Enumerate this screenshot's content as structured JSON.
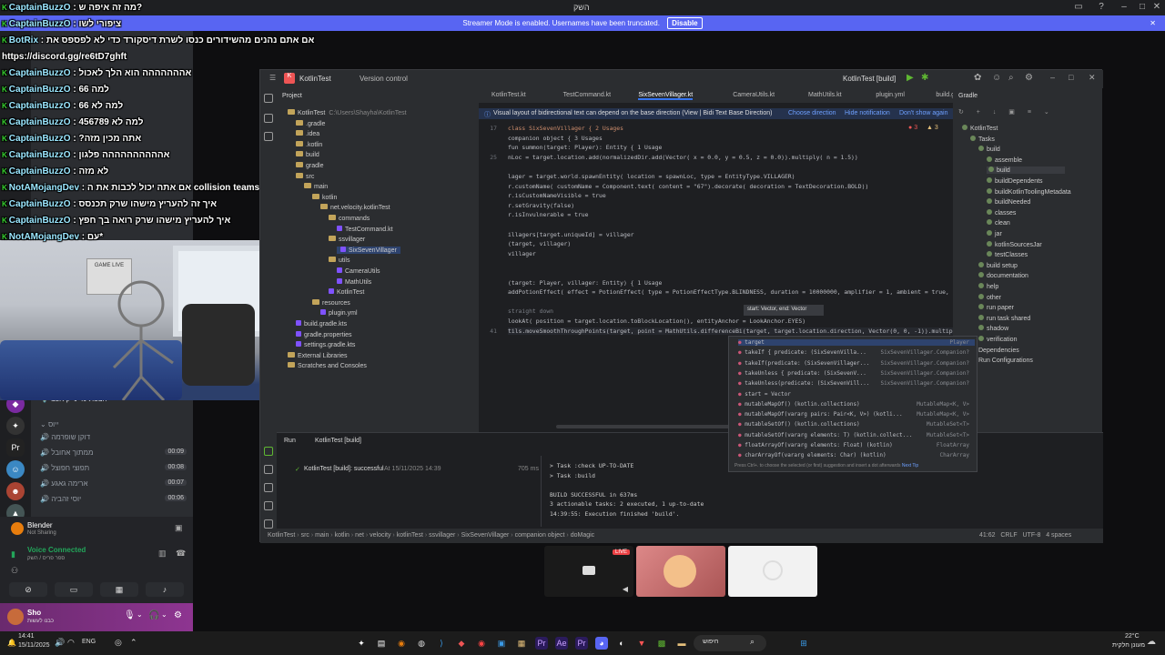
{
  "discord": {
    "window_title": "השק",
    "streamer_banner": "Streamer Mode is enabled. Usernames have been truncated.",
    "disable_label": "Disable",
    "voice": {
      "status": "Voice Connected",
      "sub": "ספר פריס / השק",
      "app_name": "Blender",
      "app_sub": "Not Sharing"
    },
    "user": {
      "name": "Sho",
      "sub": "כבנו לעשות"
    },
    "channels_header": "ייוס",
    "channels": [
      {
        "name": "דוקן שופרמה",
        "count": ""
      },
      {
        "name": "ממתוך אחובל",
        "count": "00:09"
      },
      {
        "name": "תפוצי חפוצל",
        "count": "00:08"
      },
      {
        "name": "ארימה גאגע",
        "count": "00:07"
      },
      {
        "name": "יוסי זהביה",
        "count": "00:06"
      }
    ],
    "channel_highlight": "הצפת-מי-נייק אפצ",
    "live_badge": "LIVE"
  },
  "chat": [
    {
      "user": "CaptainBuzzO",
      "text": "מה זה איפה ש?"
    },
    {
      "user": "CaptainBuzzO",
      "text": "ציפורי לשו"
    },
    {
      "user": "BotRix",
      "text": "אם אתם נהנים מהשידורים כנסו לשרת דיסקורד כדי לא לפספס את"
    },
    {
      "user": "",
      "text": "https://discord.gg/re6tD7ghft"
    },
    {
      "user": "CaptainBuzzO",
      "text": "אההההההה הוא הלך לאכול"
    },
    {
      "user": "CaptainBuzzO",
      "text": "למה 66"
    },
    {
      "user": "CaptainBuzzO",
      "text": "למה לא 66"
    },
    {
      "user": "CaptainBuzzO",
      "text": "למה לא 456789"
    },
    {
      "user": "CaptainBuzzO",
      "text": "?אתה מכין מזה"
    },
    {
      "user": "CaptainBuzzO",
      "text": "אהההההההההה פלגון"
    },
    {
      "user": "CaptainBuzzO",
      "text": "לא מזה"
    },
    {
      "user": "NotAMojangDev",
      "text": "אם אתה יכול לכבות את ה collision teams"
    },
    {
      "user": "CaptainBuzzO",
      "text": "איך זה להעריץ מישהו שרק תכנסס"
    },
    {
      "user": "CaptainBuzzO",
      "text": "איך להעריץ מישהו שרק רואה בך חפץ"
    },
    {
      "user": "NotAMojangDev",
      "text": "עם*"
    }
  ],
  "ide": {
    "project_name": "KotlinTest",
    "vcs": "Version control",
    "run_config": "KotlinTest [build]",
    "tabs": [
      "KotlinTest.kt",
      "TestCommand.kt",
      "SixSevenVillager.kt",
      "CameraUtils.kt",
      "MathUtils.kt",
      "plugin.yml",
      "build.gradle"
    ],
    "active_tab": "SixSevenVillager.kt",
    "notice": "Visual layout of bidirectional text can depend on the base direction (View | Bidi Text Base Direction)",
    "notice_actions": [
      "Choose direction",
      "Hide notification",
      "Don't show again"
    ],
    "project_panel_title": "Project",
    "project_tree": [
      {
        "label": "KotlinTest",
        "note": "C:\\Users\\Shayha\\KotlinTest",
        "type": "folder",
        "level": 0
      },
      {
        "label": ".gradle",
        "type": "folder",
        "level": 1
      },
      {
        "label": ".idea",
        "type": "folder",
        "level": 1
      },
      {
        "label": ".kotlin",
        "type": "folder",
        "level": 1
      },
      {
        "label": "build",
        "type": "folder",
        "level": 1
      },
      {
        "label": "gradle",
        "type": "folder",
        "level": 1
      },
      {
        "label": "src",
        "type": "folder",
        "level": 1
      },
      {
        "label": "main",
        "type": "folder",
        "level": 2
      },
      {
        "label": "kotlin",
        "type": "folder",
        "level": 3
      },
      {
        "label": "net.velocity.kotlinTest",
        "type": "folder",
        "level": 4
      },
      {
        "label": "commands",
        "type": "folder",
        "level": 5
      },
      {
        "label": "TestCommand.kt",
        "type": "kt",
        "level": 6
      },
      {
        "label": "ssvillager",
        "type": "folder",
        "level": 5
      },
      {
        "label": "SixSevenVillager",
        "type": "kt",
        "level": 6
      },
      {
        "label": "utils",
        "type": "folder",
        "level": 5
      },
      {
        "label": "CameraUtils",
        "type": "kt",
        "level": 6
      },
      {
        "label": "MathUtils",
        "type": "kt",
        "level": 6
      },
      {
        "label": "KotlinTest",
        "type": "kt",
        "level": 5
      },
      {
        "label": "resources",
        "type": "folder",
        "level": 3
      },
      {
        "label": "plugin.yml",
        "type": "kt",
        "level": 4
      },
      {
        "label": "build.gradle.kts",
        "type": "kt",
        "level": 1
      },
      {
        "label": "gradle.properties",
        "type": "kt",
        "level": 1
      },
      {
        "label": "settings.gradle.kts",
        "type": "kt",
        "level": 1
      },
      {
        "label": "External Libraries",
        "type": "folder",
        "level": 0
      },
      {
        "label": "Scratches and Consoles",
        "type": "folder",
        "level": 0
      }
    ],
    "gradle_title": "Gradle",
    "gradle_tree": [
      {
        "label": "KotlinTest",
        "level": 0
      },
      {
        "label": "Tasks",
        "level": 1
      },
      {
        "label": "build",
        "level": 2
      },
      {
        "label": "assemble",
        "level": 3
      },
      {
        "label": "build",
        "level": 3
      },
      {
        "label": "buildDependents",
        "level": 3
      },
      {
        "label": "buildKotlinToolingMetadata",
        "level": 3
      },
      {
        "label": "buildNeeded",
        "level": 3
      },
      {
        "label": "classes",
        "level": 3
      },
      {
        "label": "clean",
        "level": 3
      },
      {
        "label": "jar",
        "level": 3
      },
      {
        "label": "kotlinSourcesJar",
        "level": 3
      },
      {
        "label": "testClasses",
        "level": 3
      },
      {
        "label": "build setup",
        "level": 2
      },
      {
        "label": "documentation",
        "level": 2
      },
      {
        "label": "help",
        "level": 2
      },
      {
        "label": "other",
        "level": 2
      },
      {
        "label": "run paper",
        "level": 2
      },
      {
        "label": "run task shared",
        "level": 2
      },
      {
        "label": "shadow",
        "level": 2
      },
      {
        "label": "verification",
        "level": 2
      },
      {
        "label": "Dependencies",
        "level": 1
      },
      {
        "label": "Run Configurations",
        "level": 1
      }
    ],
    "code_lines": [
      {
        "n": "17",
        "t": "class SixSevenVillager {  2 Usages"
      },
      {
        "n": "",
        "t": "    companion object {  3 Usages"
      },
      {
        "n": "",
        "t": "        fun summon(target: Player): Entity {  1 Usage"
      },
      {
        "n": "25",
        "t": "nLoc = target.location.add(normalizedDir.add(Vector( x = 0.0,  y = 0.5,  z = 0.0)).multiply( n = 1.5))"
      },
      {
        "n": "",
        "t": ""
      },
      {
        "n": "",
        "t": "lager = target.world.spawnEntity( location = spawnLoc,  type = EntityType.VILLAGER)"
      },
      {
        "n": "",
        "t": "r.customName( customName = Component.text( content = \"67\").decorate( decoration = TextDecoration.BOLD))"
      },
      {
        "n": "",
        "t": "r.isCustomNameVisible = true"
      },
      {
        "n": "",
        "t": "r.setGravity(false)"
      },
      {
        "n": "",
        "t": "r.isInvulnerable = true"
      },
      {
        "n": "",
        "t": ""
      },
      {
        "n": "",
        "t": "illagers[target.uniqueId] = villager"
      },
      {
        "n": "",
        "t": "(target, villager)"
      },
      {
        "n": "",
        "t": "villager"
      },
      {
        "n": "",
        "t": ""
      },
      {
        "n": "",
        "t": ""
      },
      {
        "n": "",
        "t": "(target: Player, villager: Entity) {  1 Usage"
      },
      {
        "n": "",
        "t": "addPotionEffect( effect = PotionEffect( type = PotionEffectType.BLINDNESS,  duration = 10000000,  amplifier = 1,  ambient = true,  partic"
      },
      {
        "n": "",
        "t": ""
      },
      {
        "n": "",
        "t": " straight down"
      },
      {
        "n": "",
        "t": "lookAt( position = target.location.toBlockLocation(),  entityAnchor = LookAnchor.EYES)"
      },
      {
        "n": "41",
        "t": "tils.moveSmoothThroughPoints(target,  point = MathUtils.differenceBi(target, target.location.direction, Vector(0, 0, -1)).multiply(1.7"
      }
    ],
    "param_tip": "start: Vector, end: Vector",
    "autocomplete": [
      {
        "name": "target",
        "type": "Player"
      },
      {
        "name": "takeIf { predicate: (SixSevenVilla...",
        "type": "SixSevenVillager.Companion?"
      },
      {
        "name": "takeIf(predicate: (SixSevenVillager...",
        "type": "SixSevenVillager.Companion?"
      },
      {
        "name": "takeUnless { predicate: (SixSevenV...",
        "type": "SixSevenVillager.Companion?"
      },
      {
        "name": "takeUnless(predicate: (SixSevenVill...",
        "type": "SixSevenVillager.Companion?"
      },
      {
        "name": "start = Vector",
        "type": ""
      },
      {
        "name": "mutableMapOf() (kotlin.collections)",
        "type": "MutableMap<K, V>"
      },
      {
        "name": "mutableMapOf(vararg pairs: Pair<K, V>) (kotli...",
        "type": "MutableMap<K, V>"
      },
      {
        "name": "mutableSetOf() (kotlin.collections)",
        "type": "MutableSet<T>"
      },
      {
        "name": "mutableSetOf(vararg elements: T) (kotlin.collect...",
        "type": "MutableSet<T>"
      },
      {
        "name": "floatArrayOf(vararg elements: Float) (kotlin)",
        "type": "FloatArray"
      },
      {
        "name": "charArrayOf(vararg elements: Char) (kotlin)",
        "type": "CharArray"
      }
    ],
    "ac_footer": "Press Ctrl+. to choose the selected (or first) suggestion and insert a dot afterwards",
    "ac_footer_link": "Next Tip",
    "run_tab": "Run",
    "run_config_tab": "KotlinTest [build]",
    "run_tree_item": "KotlinTest [build]: successful",
    "run_tree_time": "At 15/11/2025 14:39",
    "run_tree_duration": "705 ms",
    "console": [
      "> Task :check UP-TO-DATE",
      "> Task :build",
      "",
      "BUILD SUCCESSFUL in 637ms",
      "3 actionable tasks: 2 executed, 1 up-to-date",
      "14:39:55: Execution finished 'build'."
    ],
    "breadcrumb": [
      "KotlinTest",
      "src",
      "main",
      "kotlin",
      "net",
      "velocity",
      "kotlinTest",
      "ssvillager",
      "SixSevenVillager",
      "companion object",
      "doMagic"
    ],
    "status_right": [
      "41:62",
      "CRLF",
      "UTF-8",
      "4 spaces"
    ],
    "problems": "3",
    "warnings": "3"
  },
  "webcam": {
    "poster_text": "GAME LIVE"
  },
  "taskbar": {
    "time": "14:41",
    "date": "15/11/2025",
    "lang": "ENG",
    "weather_temp": "22°C",
    "weather_text": "מעונן חלקית",
    "search": "חיפוש"
  },
  "colors": {
    "discord_blurple": "#5865f2",
    "ide_bg": "#1e1f22",
    "panel_bg": "#2b2d30",
    "success": "#5fb832"
  }
}
